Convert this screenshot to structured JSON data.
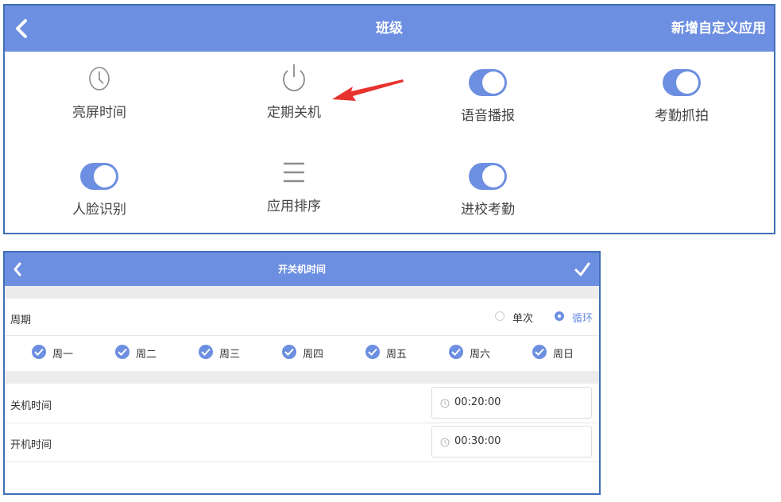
{
  "panel_top": {
    "title": "班级",
    "add_label": "新增自定义应用",
    "tiles": [
      {
        "label": "亮屏时间",
        "icon": "clock-icon"
      },
      {
        "label": "定期关机",
        "icon": "power-icon"
      },
      {
        "label": "语音播报",
        "icon": "toggle-on-icon",
        "on": true
      },
      {
        "label": "考勤抓拍",
        "icon": "toggle-on-icon",
        "on": true
      },
      {
        "label": "人脸识别",
        "icon": "toggle-on-icon",
        "on": true
      },
      {
        "label": "应用排序",
        "icon": "menu-icon"
      },
      {
        "label": "进校考勤",
        "icon": "toggle-on-icon",
        "on": true
      }
    ],
    "annotation": "red-arrow-icon"
  },
  "panel_bottom": {
    "title": "开关机时间",
    "cycle_label": "周期",
    "options": [
      {
        "label": "单次",
        "selected": false
      },
      {
        "label": "循环",
        "selected": true
      }
    ],
    "days": [
      {
        "label": "周一",
        "checked": true
      },
      {
        "label": "周二",
        "checked": true
      },
      {
        "label": "周三",
        "checked": true
      },
      {
        "label": "周四",
        "checked": true
      },
      {
        "label": "周五",
        "checked": true
      },
      {
        "label": "周六",
        "checked": true
      },
      {
        "label": "周日",
        "checked": true
      }
    ],
    "shutdown": {
      "label": "关机时间",
      "value": "00:20:00"
    },
    "startup": {
      "label": "开机时间",
      "value": "00:30:00"
    }
  },
  "colors": {
    "accent": "#6d8fe1",
    "border": "#3f6fb6",
    "arrow": "#e8322d"
  }
}
